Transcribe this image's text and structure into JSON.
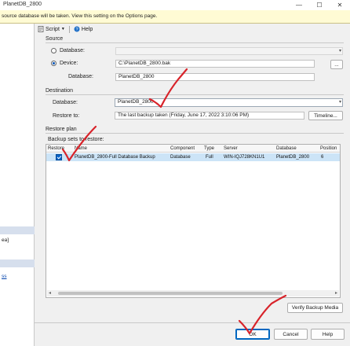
{
  "window": {
    "title": "PlanetDB_2800"
  },
  "info_bar": {
    "text": "source database will be taken. View this setting on the Options page."
  },
  "toolbar": {
    "script_label": "Script",
    "help_label": "Help"
  },
  "source": {
    "section_label": "Source",
    "database_option": "Database:",
    "device_option": "Device:",
    "device_path": "C:\\PlanetDB_2800.bak",
    "browse_label": "...",
    "database_label": "Database:",
    "database_value": "PlanetDB_2800"
  },
  "destination": {
    "section_label": "Destination",
    "database_label": "Database:",
    "database_value": "PlanetDB_2800",
    "restore_to_label": "Restore to:",
    "restore_to_value": "The last backup taken (Friday, June 17, 2022 3:10:06 PM)",
    "timeline_label": "Timeline..."
  },
  "restore_plan": {
    "section_label": "Restore plan",
    "backup_sets_label": "Backup sets to restore:",
    "columns": [
      "Restore",
      "Name",
      "Component",
      "Type",
      "Server",
      "Database",
      "Position"
    ],
    "rows": [
      {
        "checked": true,
        "name": "PlanetDB_2800-Full Database Backup",
        "component": "Database",
        "type": "Full",
        "server": "WIN-IQJ728KN1U1",
        "database": "PlanetDB_2800",
        "position": "6"
      }
    ]
  },
  "left_pane": {
    "fragment_1": "ea]",
    "fragment_2": "ss"
  },
  "buttons": {
    "verify_label": "Verify Backup Media",
    "ok_label": "OK",
    "cancel_label": "Cancel",
    "help_label": "Help"
  },
  "colors": {
    "annotation": "#d8232a",
    "selection": "#cce4f7",
    "info_bar": "#fffbd4"
  }
}
